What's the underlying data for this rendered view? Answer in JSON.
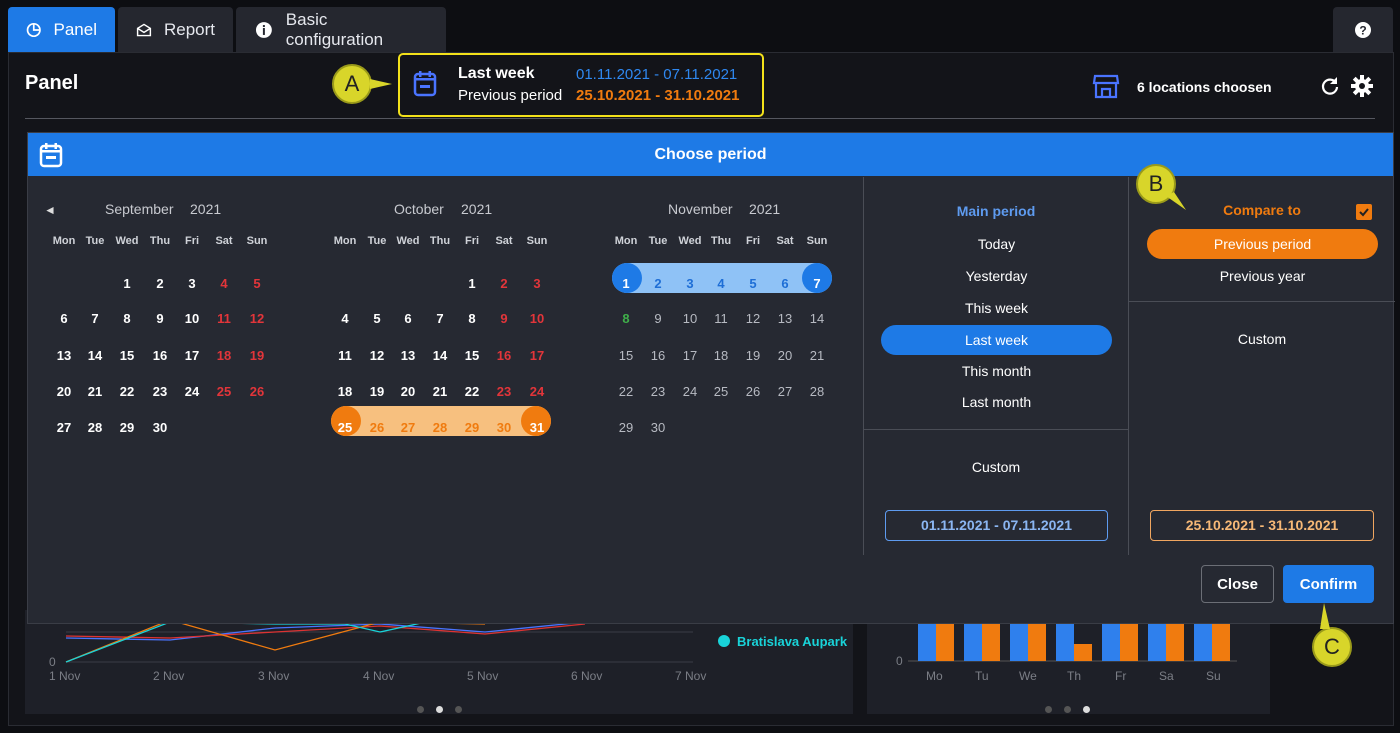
{
  "tabs": [
    {
      "label": "Panel"
    },
    {
      "label": "Report"
    },
    {
      "label": "Basic configuration"
    }
  ],
  "header": {
    "title": "Panel",
    "period_label": "Last week",
    "period_range": "01.11.2021 - 07.11.2021",
    "compare_label": "Previous period",
    "compare_range": "25.10.2021 - 31.10.2021",
    "locations": "6 locations choosen"
  },
  "callouts": {
    "a": "A",
    "b": "B",
    "c": "C"
  },
  "modal": {
    "title": "Choose period",
    "months": [
      {
        "name": "September",
        "year": "2021"
      },
      {
        "name": "October",
        "year": "2021"
      },
      {
        "name": "November",
        "year": "2021"
      }
    ],
    "weekdays": [
      "Mon",
      "Tue",
      "Wed",
      "Thu",
      "Fri",
      "Sat",
      "Sun"
    ],
    "main_period": {
      "title": "Main period",
      "options": [
        "Today",
        "Yesterday",
        "This week",
        "Last week",
        "This month",
        "Last month"
      ],
      "custom": "Custom",
      "range": "01.11.2021 - 07.11.2021"
    },
    "compare": {
      "title": "Compare to",
      "options": [
        "Previous period",
        "Previous year"
      ],
      "custom": "Custom",
      "range": "25.10.2021 - 31.10.2021"
    },
    "close": "Close",
    "confirm": "Confirm"
  },
  "background": {
    "legend": [
      "Bratislava Aupark"
    ],
    "x_ticks": [
      "1 Nov",
      "2 Nov",
      "3 Nov",
      "4 Nov",
      "5 Nov",
      "6 Nov",
      "7 Nov"
    ],
    "y_zero": "0",
    "bar_days": [
      "Mo",
      "Tu",
      "We",
      "Th",
      "Fr",
      "Sa",
      "Su"
    ]
  },
  "colors": {
    "accent": "#1e7ae6",
    "orange": "#f07b0f",
    "highlight": "#f3e11a"
  }
}
